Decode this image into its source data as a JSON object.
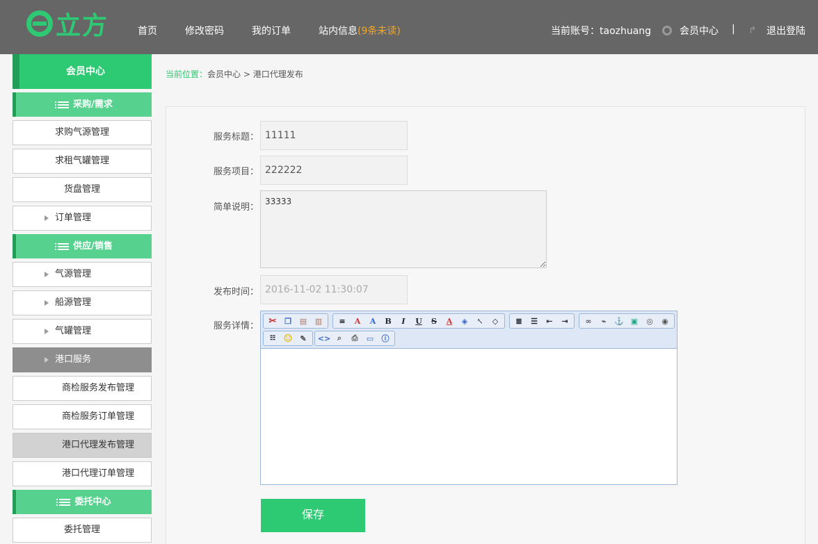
{
  "header": {
    "logo_text": "立方",
    "nav": [
      {
        "label": "首页"
      },
      {
        "label": "修改密码"
      },
      {
        "label": "我的订单"
      },
      {
        "label": "站内信息",
        "badge": "(9条未读)"
      }
    ],
    "account_label": "当前账号：",
    "account_name": "taozhuang",
    "member_center": "会员中心",
    "divider": "|",
    "logout": "退出登陆"
  },
  "sidebar": {
    "title": "会员中心",
    "categories": [
      {
        "label": "采购/需求"
      },
      {
        "label": "供应/销售"
      },
      {
        "label": "委托中心"
      }
    ],
    "items": [
      {
        "label": "求购气源管理"
      },
      {
        "label": "求租气罐管理"
      },
      {
        "label": "货盘管理"
      },
      {
        "label": "订单管理"
      },
      {
        "label": "气源管理"
      },
      {
        "label": "船源管理"
      },
      {
        "label": "气罐管理"
      },
      {
        "label": "港口服务"
      },
      {
        "label": "商检服务发布管理"
      },
      {
        "label": "商检服务订单管理"
      },
      {
        "label": "港口代理发布管理"
      },
      {
        "label": "港口代理订单管理"
      },
      {
        "label": "委托管理"
      }
    ]
  },
  "breadcrumb": {
    "here": "当前位置：",
    "path": "会员中心 > 港口代理发布"
  },
  "form": {
    "title_label": "服务标题：",
    "title_value": "11111",
    "item_label": "服务项目：",
    "item_value": "222222",
    "desc_label": "简单说明：",
    "desc_value": "33333",
    "time_label": "发布时间：",
    "time_value": "2016-11-02 11:30:07",
    "detail_label": "服务详情：",
    "save": "保存"
  },
  "colors": {
    "accent": "#2ec973",
    "header_bg": "#666666",
    "unread": "#f5a623"
  }
}
